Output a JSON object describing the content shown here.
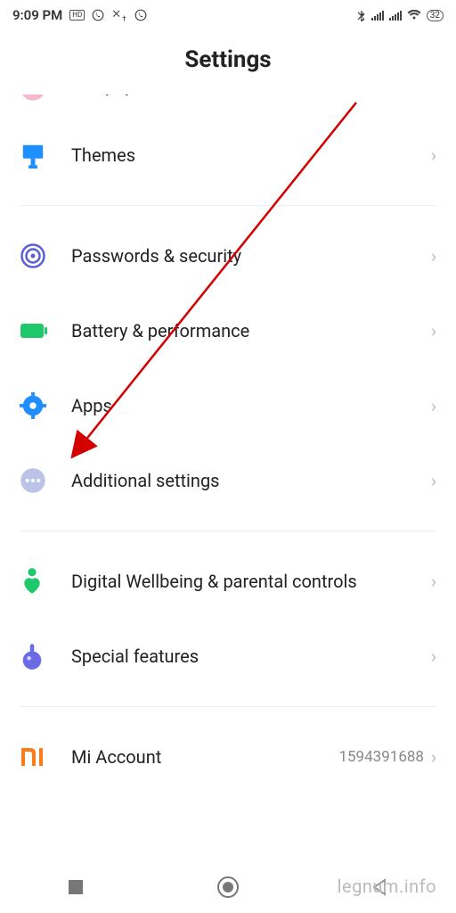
{
  "status": {
    "time": "9:09 PM",
    "battery_percent": "32"
  },
  "header": {
    "title": "Settings"
  },
  "items": {
    "wallpaper": {
      "label": "Wallpaper"
    },
    "themes": {
      "label": "Themes"
    },
    "passwords": {
      "label": "Passwords & security"
    },
    "battery": {
      "label": "Battery & performance"
    },
    "apps": {
      "label": "Apps"
    },
    "additional": {
      "label": "Additional settings"
    },
    "wellbeing": {
      "label": "Digital Wellbeing & parental controls"
    },
    "special": {
      "label": "Special features"
    },
    "mi_account": {
      "label": "Mi Account",
      "value": "1594391688"
    }
  },
  "watermark": "legnum.info"
}
